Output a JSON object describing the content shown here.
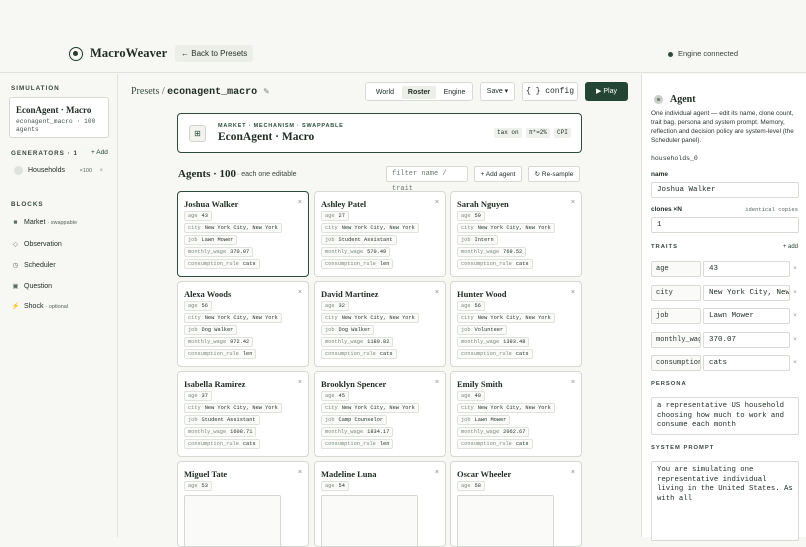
{
  "app": {
    "name": "MacroWeaver",
    "back_label": "Back to Presets",
    "connection": "Engine connected"
  },
  "sidebar": {
    "simulation_label": "SIMULATION",
    "sim_name": "EconAgent · Macro",
    "sim_meta": "econagent_macro · 100 agents",
    "generators_label": "GENERATORS · 1",
    "add_label": "+ Add",
    "generator": {
      "name": "Households",
      "count": "×100"
    },
    "blocks_label": "BLOCKS",
    "blocks": [
      {
        "name": "Market",
        "suffix": "· swappable",
        "icon": "square-icon"
      },
      {
        "name": "Observation",
        "suffix": "",
        "icon": "diamond-icon"
      },
      {
        "name": "Scheduler",
        "suffix": "",
        "icon": "clock-icon"
      },
      {
        "name": "Question",
        "suffix": "",
        "icon": "square-icon"
      },
      {
        "name": "Shock",
        "suffix": "· optional",
        "icon": "lightning-icon"
      }
    ]
  },
  "header": {
    "crumb_prefix": "Presets /",
    "crumb_current": "econagent_macro",
    "tabs": [
      "World",
      "Roster",
      "Engine"
    ],
    "active_tab": "Roster",
    "save_label": "Save ▾",
    "config_label": "{ } config",
    "play_label": "▶ Play"
  },
  "env": {
    "tags": "MARKET · MECHANISM · SWAPPABLE",
    "name": "EconAgent · Macro",
    "chips": [
      "tax on",
      "π*=2%",
      "CPI"
    ]
  },
  "agents": {
    "title": "Agents · 100",
    "subtitle": "· each one editable",
    "filter_placeholder": "filter name / trait",
    "add_label": "+ Add agent",
    "resample_label": "↻ Re-sample",
    "k": {
      "age": "age",
      "city": "city",
      "job": "job",
      "wage": "monthly_wage",
      "rule": "consumption_rule"
    },
    "list": [
      {
        "name": "Joshua Walker",
        "age": "43",
        "city": "New York City, New York",
        "job": "Lawn Mower",
        "wage": "370.07",
        "rule": "cats"
      },
      {
        "name": "Ashley Patel",
        "age": "27",
        "city": "New York City, New York",
        "job": "Student Assistant",
        "wage": "570.49",
        "rule": "len"
      },
      {
        "name": "Sarah Nguyen",
        "age": "59",
        "city": "New York City, New York",
        "job": "Intern",
        "wage": "769.52",
        "rule": "cats"
      },
      {
        "name": "Alexa Woods",
        "age": "56",
        "city": "New York City, New York",
        "job": "Dog Walker",
        "wage": "972.42",
        "rule": "len"
      },
      {
        "name": "David Martinez",
        "age": "32",
        "city": "New York City, New York",
        "job": "Dog Walker",
        "wage": "1180.82",
        "rule": "cats"
      },
      {
        "name": "Hunter Wood",
        "age": "56",
        "city": "New York City, New York",
        "job": "Volunteer",
        "wage": "1393.48",
        "rule": "cats"
      },
      {
        "name": "Isabella Ramirez",
        "age": "37",
        "city": "New York City, New York",
        "job": "Student Assistant",
        "wage": "1608.71",
        "rule": "cats"
      },
      {
        "name": "Brooklyn Spencer",
        "age": "45",
        "city": "New York City, New York",
        "job": "Camp Counselor",
        "wage": "1834.17",
        "rule": "len"
      },
      {
        "name": "Emily Smith",
        "age": "40",
        "city": "New York City, New York",
        "job": "Lawn Mower",
        "wage": "2062.67",
        "rule": "cats"
      },
      {
        "name": "Miguel Tate",
        "age": "53"
      },
      {
        "name": "Madeline Luna",
        "age": "54"
      },
      {
        "name": "Oscar Wheeler",
        "age": "58"
      }
    ]
  },
  "panel": {
    "title": "Agent",
    "desc": "One individual agent — edit its name, clone count, trait bag, persona and system prompt. Memory, reflection and decision policy are system-level (the Scheduler panel).",
    "id": "households_0",
    "name_label": "name",
    "name_value": "Joshua Walker",
    "clones_label": "clones ×N",
    "clones_hint": "identical copies",
    "clones_value": "1",
    "traits_label": "TRAITS",
    "traits_add": "+ add",
    "traits": [
      {
        "k": "age",
        "v": "43"
      },
      {
        "k": "city",
        "v": "New York City, New York"
      },
      {
        "k": "job",
        "v": "Lawn Mower"
      },
      {
        "k": "monthly_wage",
        "v": "370.07"
      },
      {
        "k": "consumption_rule",
        "v": "cats"
      }
    ],
    "persona_label": "PERSONA",
    "persona": "a representative US household choosing how much to work and consume each month",
    "system_label": "SYSTEM PROMPT",
    "system": "You are simulating one representative individual living in the United States. As with all"
  }
}
